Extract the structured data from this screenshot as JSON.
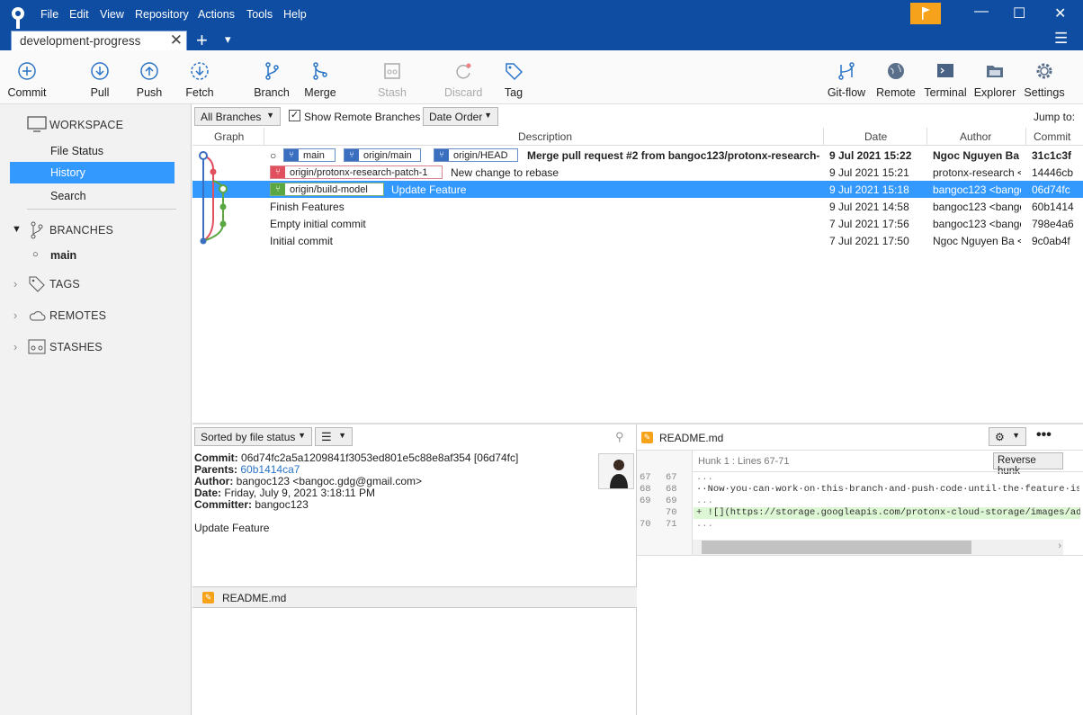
{
  "menu": [
    "File",
    "Edit",
    "View",
    "Repository",
    "Actions",
    "Tools",
    "Help"
  ],
  "tab": {
    "title": "development-progress",
    "close": "✕",
    "add": "+",
    "dropdown": "▾"
  },
  "window": {
    "min": "—",
    "max": "☐",
    "close": "✕",
    "hamburger": "☰"
  },
  "colors": {
    "accent": "#0e4da2",
    "selection": "#3399ff",
    "flag": "#f7a21b"
  },
  "toolbar": {
    "commit": "Commit",
    "pull": "Pull",
    "push": "Push",
    "fetch": "Fetch",
    "branch": "Branch",
    "merge": "Merge",
    "stash": "Stash",
    "discard": "Discard",
    "tag": "Tag",
    "gitflow": "Git-flow",
    "remote": "Remote",
    "terminal": "Terminal",
    "explorer": "Explorer",
    "settings": "Settings"
  },
  "sidebar": {
    "workspace": "WORKSPACE",
    "file_status": "File Status",
    "history": "History",
    "search": "Search",
    "branches": "BRANCHES",
    "branch_main": "main",
    "tags": "TAGS",
    "remotes": "REMOTES",
    "stashes": "STASHES"
  },
  "filter": {
    "all_branches": "All Branches",
    "show_remote": "Show Remote Branches",
    "order": "Date Order",
    "jump": "Jump to:"
  },
  "columns": {
    "graph": "Graph",
    "description": "Description",
    "date": "Date",
    "author": "Author",
    "commit": "Commit"
  },
  "commits": [
    {
      "chips": [
        "main",
        "origin/main",
        "origin/HEAD"
      ],
      "desc": "Merge pull request #2 from bangoc123/protonx-research-",
      "date": "9 Jul 2021 15:22",
      "author": "Ngoc Nguyen Ba <",
      "hash": "31c1c3f"
    },
    {
      "chips": [
        "origin/protonx-research-patch-1"
      ],
      "desc": "New change to rebase",
      "date": "9 Jul 2021 15:21",
      "author": "protonx-research <",
      "hash": "14446cb"
    },
    {
      "chips": [
        "origin/build-model"
      ],
      "desc": "Update Feature",
      "date": "9 Jul 2021 15:18",
      "author": "bangoc123 <bangoc",
      "hash": "06d74fc"
    },
    {
      "chips": [],
      "desc": "Finish Features",
      "date": "9 Jul 2021 14:58",
      "author": "bangoc123 <bangoc",
      "hash": "60b1414"
    },
    {
      "chips": [],
      "desc": "Empty initial commit",
      "date": "7 Jul 2021 17:56",
      "author": "bangoc123 <bangoc",
      "hash": "798e4a6"
    },
    {
      "chips": [],
      "desc": "Initial commit",
      "date": "7 Jul 2021 17:50",
      "author": "Ngoc Nguyen Ba <",
      "hash": "9c0ab4f"
    }
  ],
  "details": {
    "sort": "Sorted by file status",
    "commit_label": "Commit:",
    "commit_value": "06d74fc2a5a1209841f3053ed801e5c88e8af354 [06d74fc]",
    "parents_label": "Parents:",
    "parents_value": "60b1414ca7",
    "author_label": "Author:",
    "author_value": "bangoc123 <bangoc.gdg@gmail.com>",
    "date_label": "Date:",
    "date_value": "Friday, July 9, 2021 3:18:11 PM",
    "committer_label": "Committer:",
    "committer_value": "bangoc123",
    "message": "Update Feature",
    "file": "README.md"
  },
  "diff": {
    "file": "README.md",
    "hunk": "Hunk 1 : Lines 67-71",
    "reverse": "Reverse hunk",
    "lines": [
      {
        "old": "67",
        "new": "67",
        "text": "..."
      },
      {
        "old": "68",
        "new": "68",
        "text": "··Now·you·can·work·on·this·branch·and·push·code·until·the·feature·is"
      },
      {
        "old": "69",
        "new": "69",
        "text": "..."
      },
      {
        "old": "",
        "new": "70",
        "text": "+ ![](https://storage.googleapis.com/protonx-cloud-storage/images/ad"
      },
      {
        "old": "70",
        "new": "71",
        "text": "..."
      }
    ]
  }
}
